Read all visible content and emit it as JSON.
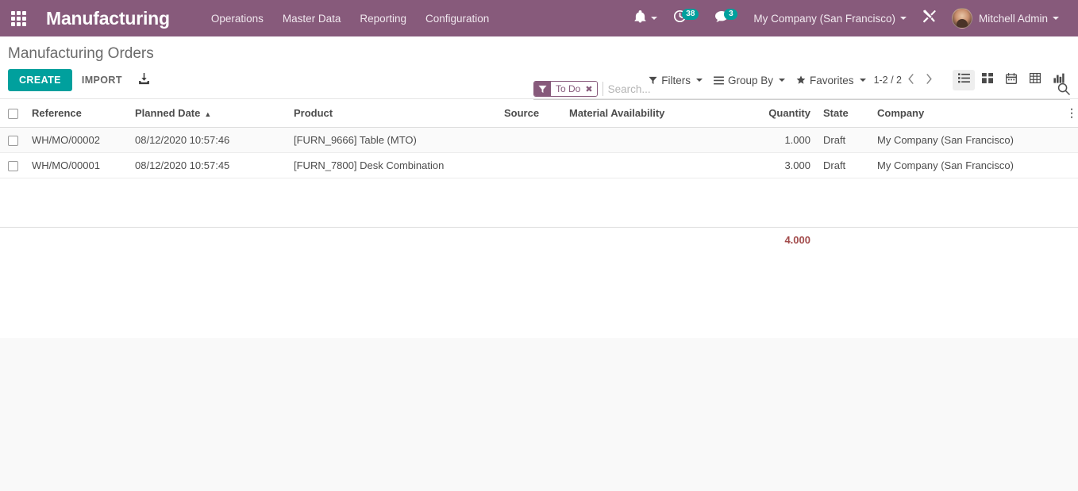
{
  "navbar": {
    "apps_icon": "apps-grid-icon",
    "brand": "Manufacturing",
    "menu_items": [
      {
        "label": "Operations"
      },
      {
        "label": "Master Data"
      },
      {
        "label": "Reporting"
      },
      {
        "label": "Configuration"
      }
    ],
    "bell_icon": "bell-icon",
    "activity_icon": "clock-activity-icon",
    "activity_count": "38",
    "messages_icon": "chat-bubble-icon",
    "messages_count": "3",
    "company": "My Company (San Francisco)",
    "debug_icon": "tools-icon",
    "user_name": "Mitchell Admin",
    "avatar_icon": "user-avatar"
  },
  "control_panel": {
    "title": "Manufacturing Orders",
    "create_label": "CREATE",
    "import_label": "IMPORT",
    "download_icon": "download-icon",
    "search": {
      "facet_icon": "filter-funnel-icon",
      "facet_label": "To Do",
      "facet_close": "✖",
      "placeholder": "Search...",
      "value": "",
      "search_icon": "magnifier-icon"
    },
    "dropdowns": [
      {
        "label": "Filters",
        "icon": "filter-funnel-icon"
      },
      {
        "label": "Group By",
        "icon": "hamburger-lines-icon"
      },
      {
        "label": "Favorites",
        "icon": "star-icon"
      }
    ],
    "pager": {
      "value": "1-2 / 2",
      "prev_icon": "chevron-left-icon",
      "next_icon": "chevron-right-icon"
    },
    "views": [
      {
        "name": "list",
        "icon": "list-view-icon",
        "active": true
      },
      {
        "name": "kanban",
        "icon": "kanban-view-icon",
        "active": false
      },
      {
        "name": "calendar",
        "icon": "calendar-view-icon",
        "active": false
      },
      {
        "name": "pivot",
        "icon": "pivot-view-icon",
        "active": false
      },
      {
        "name": "graph",
        "icon": "graph-view-icon",
        "active": false
      }
    ]
  },
  "table": {
    "columns": [
      {
        "label": "Reference",
        "align": "left"
      },
      {
        "label": "Planned Date",
        "align": "left",
        "sorted": "asc",
        "sort_glyph": "▲"
      },
      {
        "label": "Product",
        "align": "left"
      },
      {
        "label": "Source",
        "align": "left"
      },
      {
        "label": "Material Availability",
        "align": "left"
      },
      {
        "label": "Quantity",
        "align": "right"
      },
      {
        "label": "State",
        "align": "left"
      },
      {
        "label": "Company",
        "align": "left"
      }
    ],
    "optional_columns_icon": "vertical-dots-icon",
    "rows": [
      {
        "reference": "WH/MO/00002",
        "planned_date": "08/12/2020 10:57:46",
        "product": "[FURN_9666] Table (MTO)",
        "source": "",
        "material_availability": "",
        "quantity": "1.000",
        "state": "Draft",
        "company": "My Company (San Francisco)"
      },
      {
        "reference": "WH/MO/00001",
        "planned_date": "08/12/2020 10:57:45",
        "product": "[FURN_7800] Desk Combination",
        "source": "",
        "material_availability": "",
        "quantity": "3.000",
        "state": "Draft",
        "company": "My Company (San Francisco)"
      }
    ],
    "footer": {
      "quantity_total": "4.000"
    }
  },
  "colors": {
    "brand_purple": "#875A7B",
    "accent_teal": "#00A09D",
    "link_red": "#a24b4b",
    "page_bg": "#f9f9f9"
  }
}
